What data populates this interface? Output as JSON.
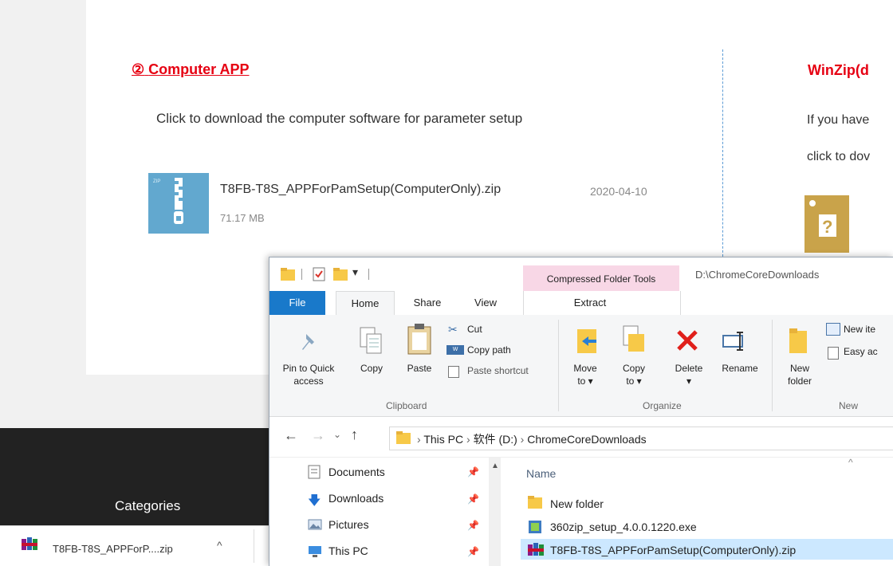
{
  "webpage": {
    "section_number": "②",
    "section_title": "Computer APP",
    "section_desc": "Click to download the computer software for parameter setup",
    "file": {
      "icon": "zip-file-icon",
      "name": "T8FB-T8S_APPForPamSetup(ComputerOnly).zip",
      "date": "2020-04-10",
      "size": "71.17 MB"
    },
    "winzip": {
      "title": "WinZip(d",
      "line1": "If you have",
      "line2": "click to dov",
      "icon": "help-file-icon"
    },
    "footer": {
      "categories": "Categories"
    }
  },
  "download_bar": {
    "file_label": "T8FB-T8S_APPForP....zip",
    "icon": "winrar-icon",
    "chevron": "^"
  },
  "explorer": {
    "quick_access_toolbar": [
      "folder-icon",
      "properties-check-icon",
      "new-folder-icon",
      "customize-dropdown"
    ],
    "context_tab": "Compressed Folder Tools",
    "window_path": "D:\\ChromeCoreDownloads",
    "tabs": {
      "file": "File",
      "home": "Home",
      "share": "Share",
      "view": "View",
      "extract": "Extract"
    },
    "ribbon": {
      "pin_label": "Pin to Quick\naccess",
      "copy_label": "Copy",
      "paste_label": "Paste",
      "cut_label": "Cut",
      "copy_path_label": "Copy path",
      "paste_shortcut_label": "Paste shortcut",
      "clipboard_group": "Clipboard",
      "move_to_label": "Move\nto ▾",
      "copy_to_label": "Copy\nto ▾",
      "delete_label": "Delete\n▾",
      "rename_label": "Rename",
      "organize_group": "Organize",
      "new_folder_label": "New\nfolder",
      "new_item_label": "New ite",
      "easy_access_label": "Easy ac",
      "new_group": "New"
    },
    "address": {
      "crumbs": [
        "This PC",
        "软件 (D:)",
        "ChromeCoreDownloads"
      ]
    },
    "nav_items": [
      {
        "label": "Documents",
        "icon": "documents-icon"
      },
      {
        "label": "Downloads",
        "icon": "downloads-icon"
      },
      {
        "label": "Pictures",
        "icon": "pictures-icon"
      },
      {
        "label": "This PC",
        "icon": "this-pc-icon"
      }
    ],
    "column_header": "Name",
    "files": [
      {
        "name": "New folder",
        "icon": "folder-icon"
      },
      {
        "name": "360zip_setup_4.0.0.1220.exe",
        "icon": "installer-icon"
      },
      {
        "name": "T8FB-T8S_APPForPamSetup(ComputerOnly).zip",
        "icon": "winrar-icon"
      }
    ]
  }
}
